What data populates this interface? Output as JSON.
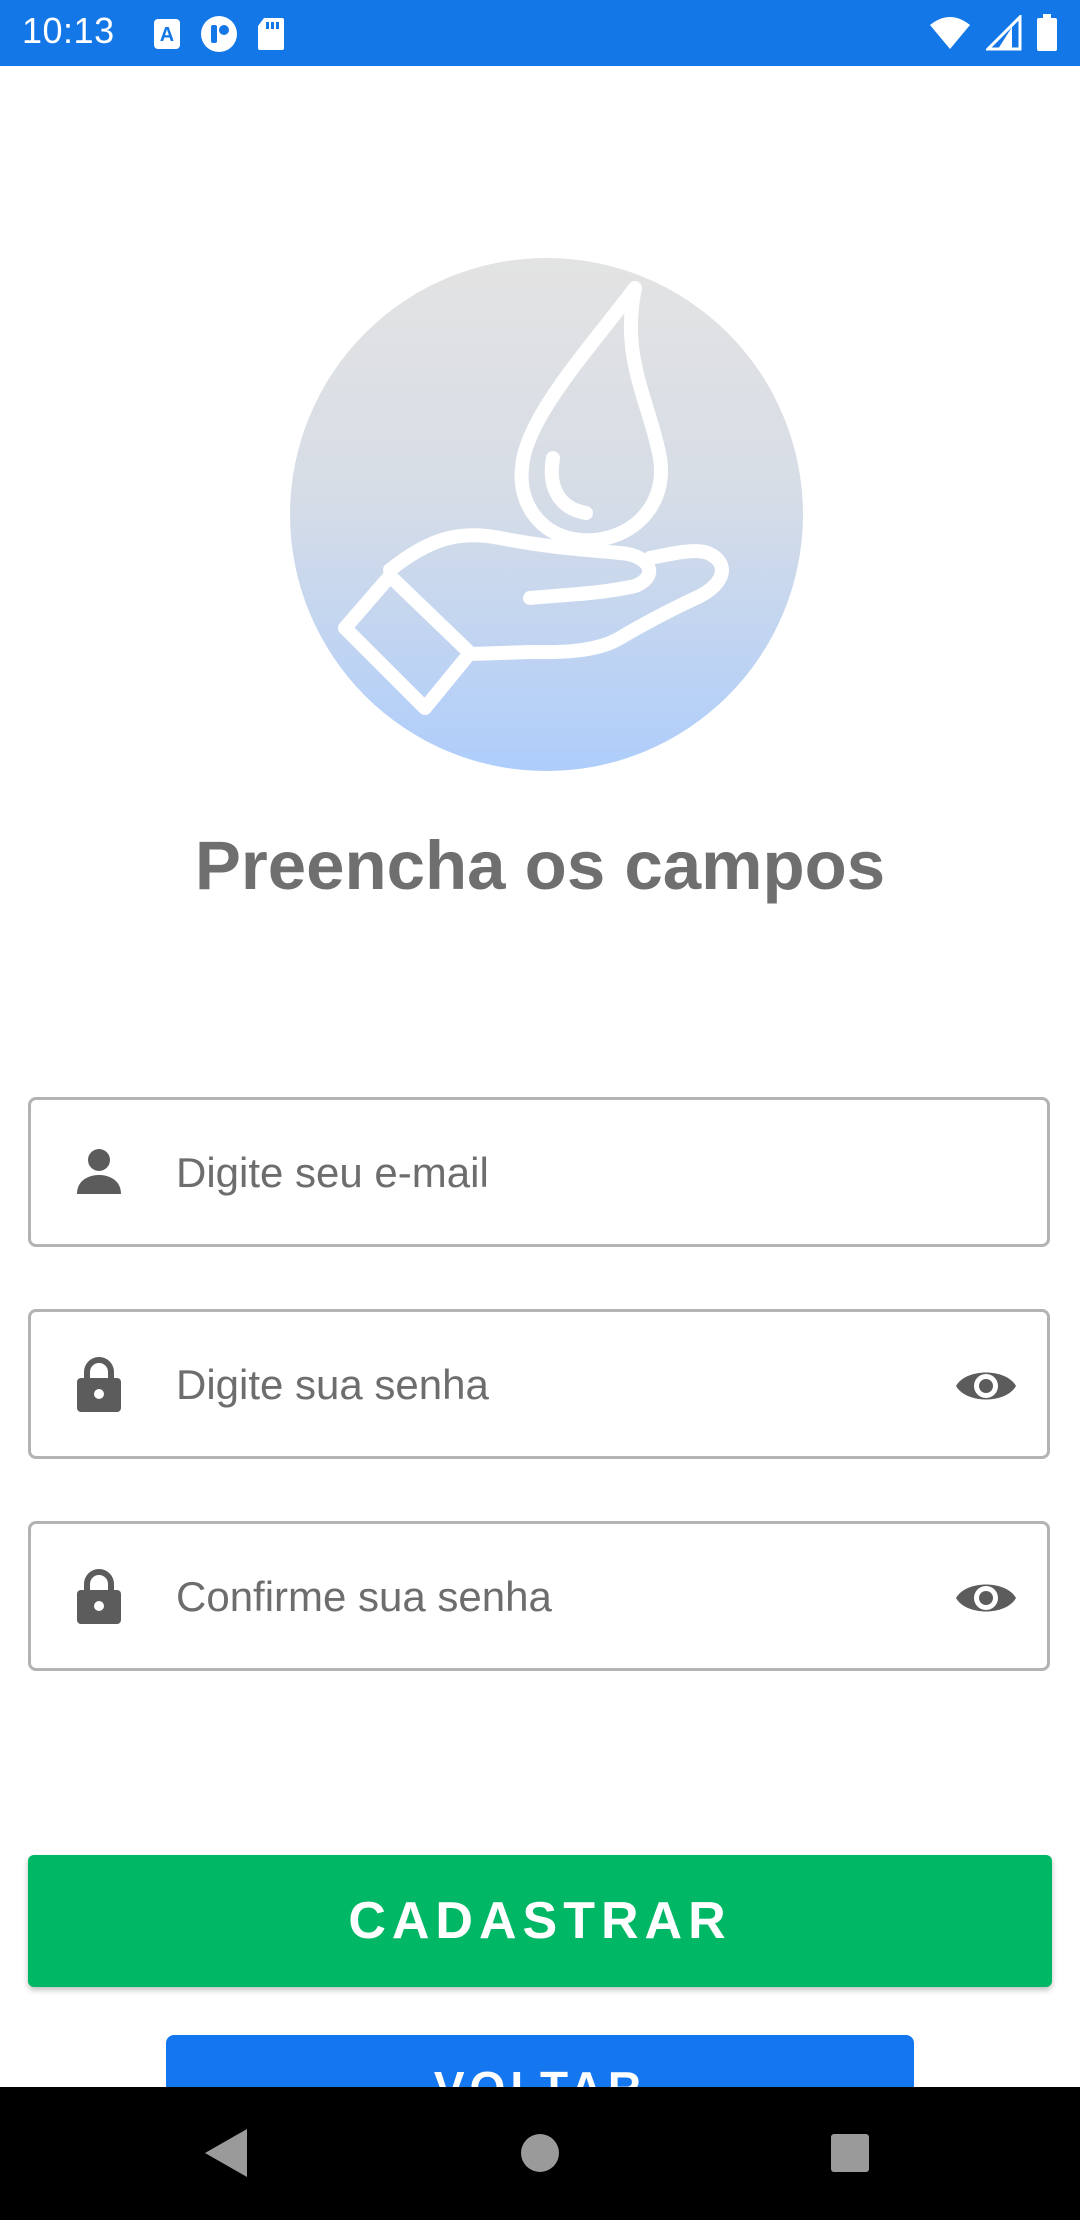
{
  "status_bar": {
    "time": "10:13",
    "left_icons": [
      "app-a-icon",
      "app-badge-icon",
      "sd-card-icon"
    ],
    "right_icons": [
      "wifi-icon",
      "cell-signal-icon",
      "battery-icon"
    ]
  },
  "logo": {
    "icon": "hand-water-drop-icon"
  },
  "title": "Preencha os campos",
  "form": {
    "email": {
      "placeholder": "Digite seu e-mail",
      "value": "",
      "icon": "person-icon"
    },
    "password": {
      "placeholder": "Digite sua senha",
      "value": "",
      "icon": "lock-icon",
      "toggle_icon": "eye-icon"
    },
    "confirm_password": {
      "placeholder": "Confirme sua senha",
      "value": "",
      "icon": "lock-icon",
      "toggle_icon": "eye-icon"
    }
  },
  "buttons": {
    "primary_label": "CADASTRAR",
    "secondary_label": "VOLTAR"
  },
  "colors": {
    "status_bar": "#1377e8",
    "primary_button": "#00b765",
    "secondary_button": "#1577f0",
    "title_text": "#6f6f6f"
  },
  "nav_bar": {
    "icons": [
      "back-icon",
      "home-icon",
      "recents-icon"
    ]
  }
}
